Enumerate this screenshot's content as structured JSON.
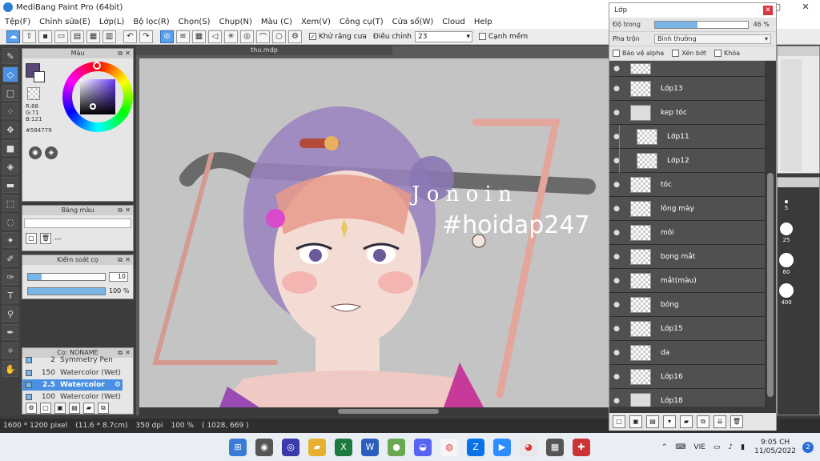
{
  "window": {
    "title": "MediBang Paint Pro (64bit)"
  },
  "menu": [
    "Tệp(F)",
    "Chỉnh sửa(E)",
    "Lớp(L)",
    "Bộ lọc(R)",
    "Chọn(S)",
    "Chụp(N)",
    "Màu (C)",
    "Xem(V)",
    "Công cụ(T)",
    "Cửa sổ(W)",
    "Cloud",
    "Help"
  ],
  "toolbar": {
    "antialias_label": "Khử răng cưa",
    "adjust_label": "Điều chỉnh",
    "adjust_value": "23",
    "smooth_label": "Cạnh mềm"
  },
  "panels": {
    "color": {
      "title": "Màu",
      "r": "R:88",
      "g": "G:71",
      "b": "B:121",
      "hex": "#584779",
      "main_color": "#584779"
    },
    "palette": {
      "title": "Bảng màu",
      "dashes": "---"
    },
    "brush_control": {
      "title": "Kiểm soát cọ",
      "size_value": "10",
      "opacity_value": "100 %",
      "opacity_fraction": 1.0
    },
    "brush": {
      "title": "Cọ: NONAME",
      "items": [
        {
          "size": "2",
          "name": "Symmetry Pen",
          "selected": false
        },
        {
          "size": "150",
          "name": "Watercolor (Wet)",
          "selected": false
        },
        {
          "size": "2.5",
          "name": "Watercolor",
          "selected": true
        },
        {
          "size": "100",
          "name": "Watercolor (Wet)",
          "selected": false
        }
      ]
    }
  },
  "canvas": {
    "tab": "thu.mdp",
    "overlay_text_1": "J o n o i n",
    "overlay_text_2": "#hoidap247"
  },
  "status": {
    "size": "1600 * 1200 pixel",
    "phys": "(11.6 * 8.7cm)",
    "dpi": "350 dpi",
    "zoom": "100 %",
    "coords": "( 1028, 669 )"
  },
  "layer_panel": {
    "title": "Lớp",
    "opacity_label": "Độ trong",
    "opacity_value": "46 %",
    "opacity_fraction": 0.46,
    "blend_label": "Pha trộn",
    "blend_value": "Bình thường",
    "opt_protect": "Bảo vệ alpha",
    "opt_clip": "Xén bớt",
    "opt_lock": "Khóa",
    "layers": [
      {
        "name": "",
        "indent": false
      },
      {
        "name": "Lớp13",
        "indent": false
      },
      {
        "name": "kep tóc",
        "indent": false
      },
      {
        "name": "Lớp11",
        "indent": true
      },
      {
        "name": "Lớp12",
        "indent": true
      },
      {
        "name": "tóc",
        "indent": false
      },
      {
        "name": "lông mày",
        "indent": false
      },
      {
        "name": "môi",
        "indent": false
      },
      {
        "name": "bọng mắt",
        "indent": false
      },
      {
        "name": "mắt(màu)",
        "indent": false
      },
      {
        "name": "bóng",
        "indent": false
      },
      {
        "name": "Lớp15",
        "indent": false
      },
      {
        "name": "da",
        "indent": false
      },
      {
        "name": "Lớp16",
        "indent": false
      },
      {
        "name": "Lớp18",
        "indent": false
      }
    ]
  },
  "brush_sizes": [
    "5",
    "25",
    "60",
    "400"
  ],
  "taskbar": {
    "lang": "VIE",
    "time": "9:05 CH",
    "date": "11/05/2022",
    "badge": "2"
  }
}
